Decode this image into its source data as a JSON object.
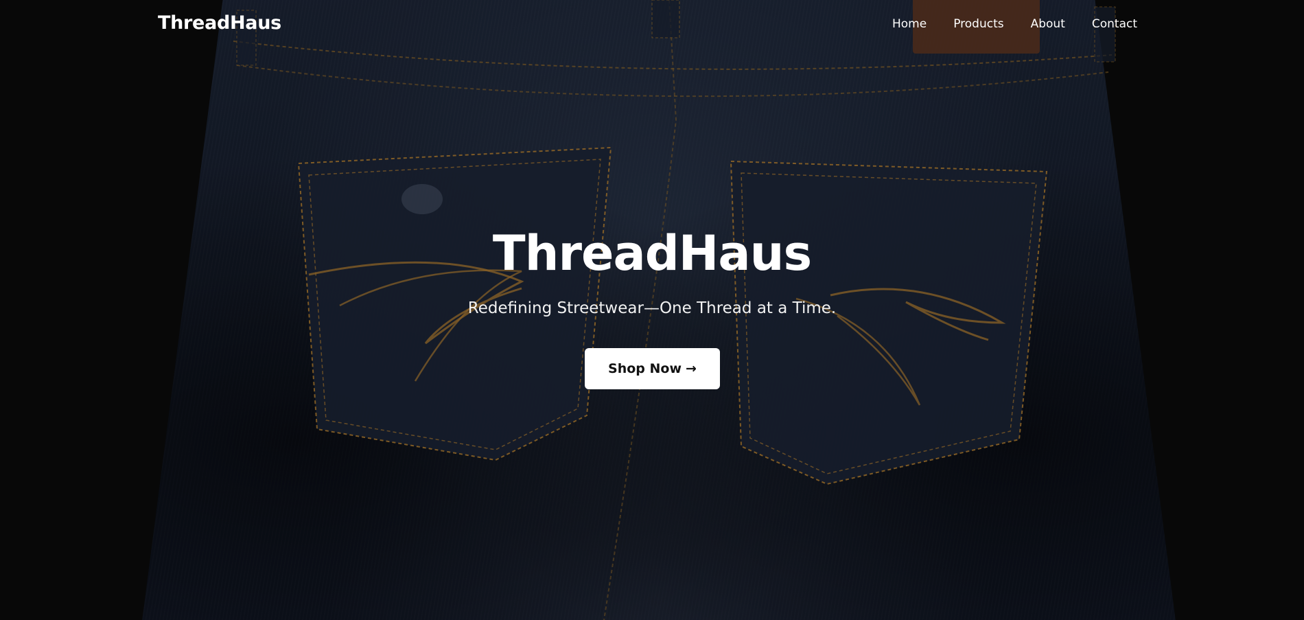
{
  "nav": {
    "brand": "ThreadHaus",
    "links": [
      {
        "label": "Home"
      },
      {
        "label": "Products"
      },
      {
        "label": "About"
      },
      {
        "label": "Contact"
      }
    ]
  },
  "hero": {
    "title": "ThreadHaus",
    "subtitle": "Redefining Streetwear—One Thread at a Time.",
    "cta_label": "Shop Now",
    "cta_arrow": "→",
    "background_image": "denim jeans back pockets with orange stitching"
  },
  "colors": {
    "page_bg": "#0b0b0b",
    "denim": "#151c2a",
    "stitch": "#a9782f",
    "patch": "#6b3a1e",
    "text": "#ffffff",
    "button_bg": "#ffffff",
    "button_text": "#111111"
  }
}
